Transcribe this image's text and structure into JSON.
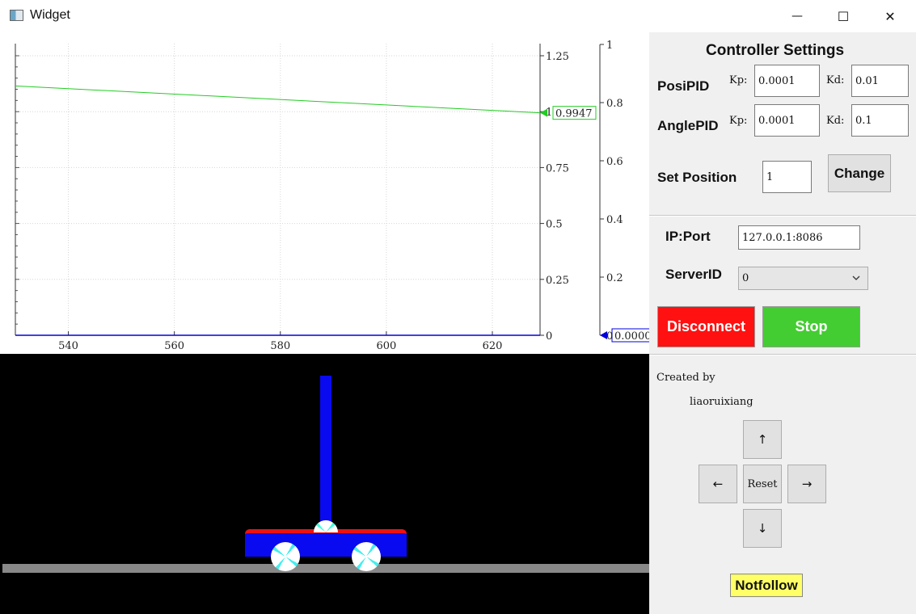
{
  "window": {
    "title": "Widget",
    "minimize": "—",
    "maximize": "☐",
    "close": "✕"
  },
  "plot": {
    "x_ticks": [
      "540",
      "560",
      "580",
      "600",
      "620"
    ],
    "left_ticks": [
      "1.25",
      "1",
      "0.75",
      "0.5",
      "0.25",
      "0"
    ],
    "right_ticks": [
      "1",
      "0.8",
      "0.6",
      "0.4",
      "0.2",
      "0"
    ],
    "green_marker": "0.9947",
    "blue_marker": "0.0000",
    "colors": {
      "green": "#22cc22",
      "blue": "#0000dd"
    }
  },
  "chart_data": {
    "type": "line",
    "series": [
      {
        "x": [
          530,
          629
        ],
        "y": [
          1.115,
          0.9947
        ],
        "color": "#22cc22",
        "axis": "left"
      },
      {
        "x": [
          530,
          629
        ],
        "y": [
          0,
          0
        ],
        "color": "#0000dd",
        "axis": "right"
      }
    ],
    "xlim": [
      530,
      629
    ],
    "ylim_left": [
      0,
      1.25
    ],
    "ylim_right": [
      0,
      1
    ],
    "grid": true
  },
  "settings": {
    "title": "Controller Settings",
    "posi_label": "PosiPID",
    "angle_label": "AnglePID",
    "kp_label": "Kp:",
    "kd_label": "Kd:",
    "posi_kp": "0.0001",
    "posi_kd": "0.01",
    "angle_kp": "0.0001",
    "angle_kd": "0.1",
    "set_position_label": "Set Position",
    "set_position_value": "1",
    "change_label": "Change"
  },
  "connection": {
    "ip_label": "IP:Port",
    "ip_value": "127.0.0.1:8086",
    "server_label": "ServerID",
    "server_value": "0",
    "disconnect_label": "Disconnect",
    "stop_label": "Stop",
    "colors": {
      "disconnect": "#ff1111",
      "stop": "#44cc33"
    }
  },
  "credits": {
    "created_by": "Created by",
    "author": "liaoruixiang"
  },
  "controls": {
    "up": "↑",
    "left": "←",
    "reset": "Reset",
    "right": "→",
    "down": "↓",
    "follow_label": "Notfollow",
    "follow_color": "#ffff66"
  }
}
